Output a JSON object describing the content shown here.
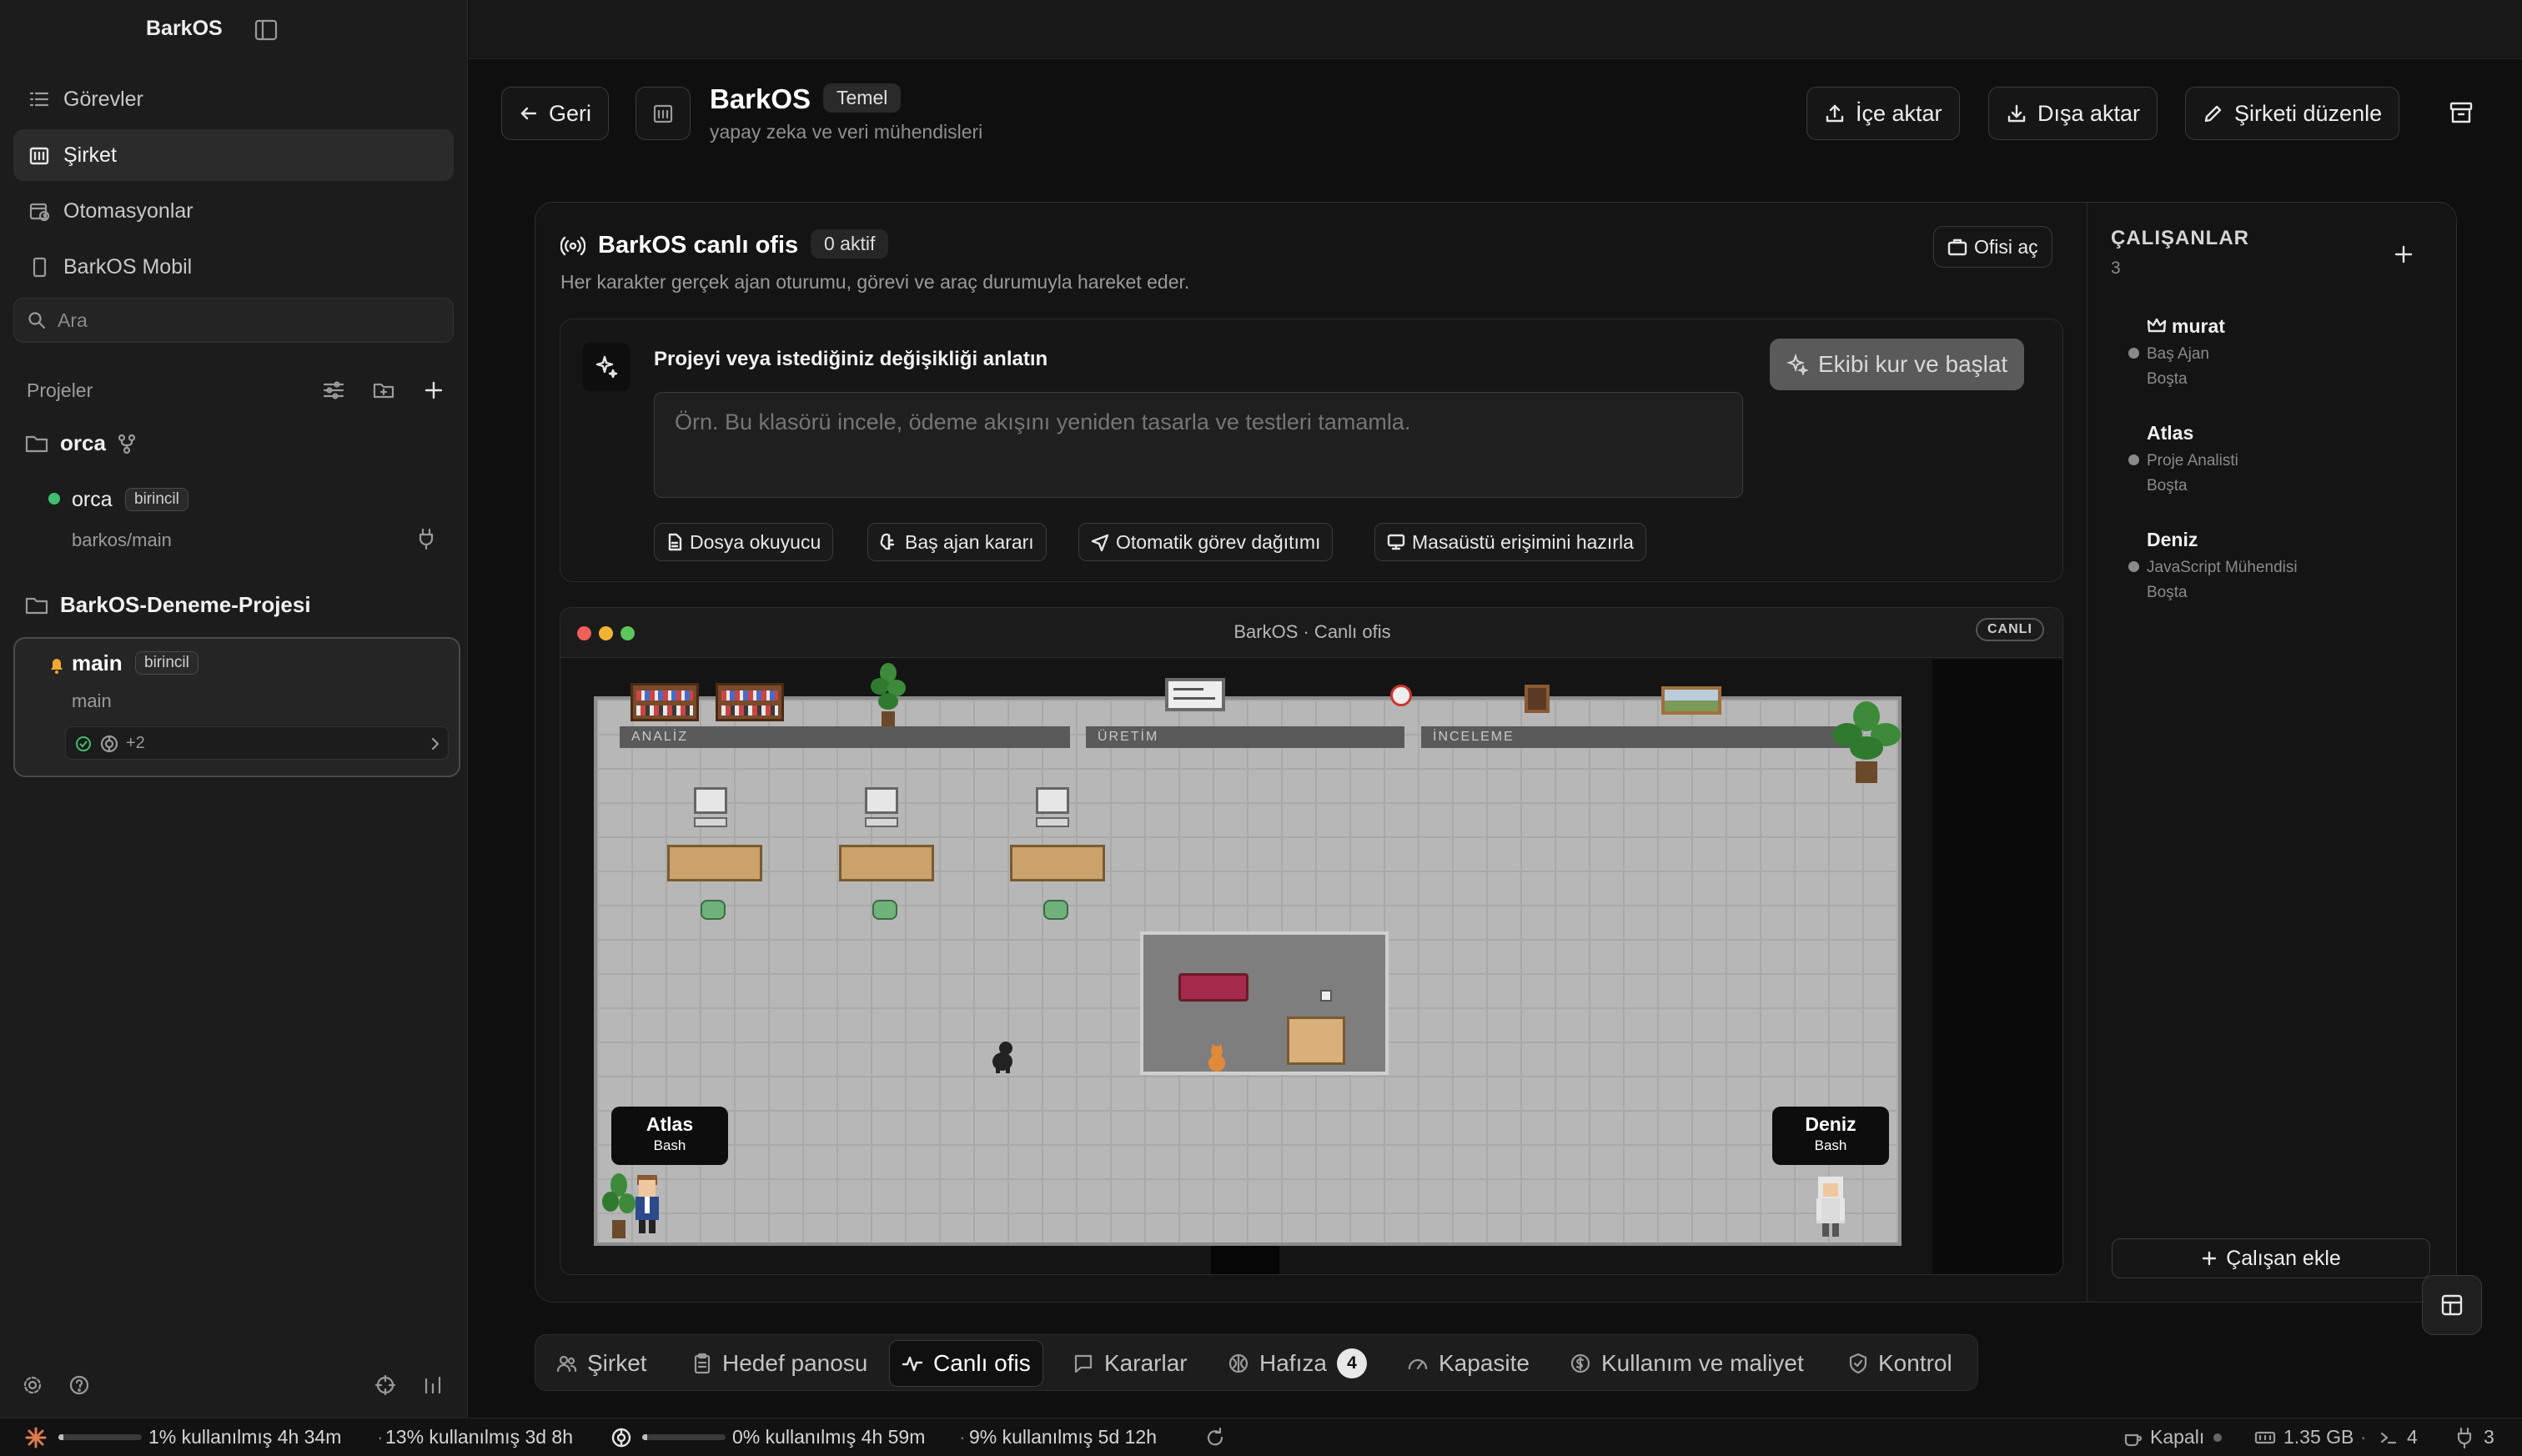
{
  "sidebar": {
    "app_title": "BarkOS",
    "nav": [
      {
        "label": "Görevler",
        "icon": "tasks-icon"
      },
      {
        "label": "Şirket",
        "icon": "company-icon",
        "active": true
      },
      {
        "label": "Otomasyonlar",
        "icon": "calendar-clock-icon"
      },
      {
        "label": "BarkOS Mobil",
        "icon": "mobile-icon"
      }
    ],
    "search_placeholder": "Ara",
    "projects_label": "Projeler",
    "projects": [
      {
        "name": "orca",
        "workspaces": [
          {
            "name": "orca",
            "badge": "birincil",
            "path": "barkos/main",
            "status": "active"
          }
        ]
      },
      {
        "name": "BarkOS-Deneme-Projesi",
        "workspaces": [
          {
            "name": "main",
            "badge": "birincil",
            "path": "main",
            "extra": "+2",
            "status": "notify"
          }
        ]
      }
    ]
  },
  "header": {
    "back_label": "Geri",
    "company_name": "BarkOS",
    "plan_badge": "Temel",
    "company_subtitle": "yapay zeka ve veri mühendisleri",
    "import_label": "İçe aktar",
    "export_label": "Dışa aktar",
    "edit_label": "Şirketi düzenle"
  },
  "office_card": {
    "title": "BarkOS canlı ofis",
    "active_badge": "0 aktif",
    "description": "Her karakter gerçek ajan oturumu, görevi ve araç durumuyla hareket eder.",
    "open_office_label": "Ofisi aç"
  },
  "composer": {
    "title": "Projeyi veya istediğiniz değişikliği anlatın",
    "placeholder": "Örn. Bu klasörü incele, ödeme akışını yeniden tasarla ve testleri tamamla.",
    "submit_label": "Ekibi kur ve başlat",
    "chips": [
      {
        "label": "Dosya okuyucu",
        "icon": "file-icon"
      },
      {
        "label": "Baş ajan kararı",
        "icon": "brain-icon"
      },
      {
        "label": "Otomatik görev dağıtımı",
        "icon": "send-icon"
      },
      {
        "label": "Masaüstü erişimini hazırla",
        "icon": "desktop-icon"
      }
    ]
  },
  "live_office": {
    "window_title": "BarkOS · Canlı ofis",
    "live_badge": "CANLI",
    "zones": [
      "ANALİZ",
      "ÜRETİM",
      "İNCELEME"
    ],
    "agents": [
      {
        "name": "Atlas",
        "tool": "Bash"
      },
      {
        "name": "Deniz",
        "tool": "Bash"
      }
    ]
  },
  "employees": {
    "title": "ÇALIŞANLAR",
    "count": "3",
    "list": [
      {
        "name": "murat",
        "role": "Baş Ajan",
        "status": "Boşta",
        "lead": true
      },
      {
        "name": "Atlas",
        "role": "Proje Analisti",
        "status": "Boşta"
      },
      {
        "name": "Deniz",
        "role": "JavaScript Mühendisi",
        "status": "Boşta"
      }
    ],
    "add_label": "Çalışan ekle"
  },
  "tabs": [
    {
      "label": "Şirket",
      "icon": "users-icon"
    },
    {
      "label": "Hedef panosu",
      "icon": "clipboard-icon"
    },
    {
      "label": "Canlı ofis",
      "icon": "activity-icon",
      "active": true
    },
    {
      "label": "Kararlar",
      "icon": "message-icon"
    },
    {
      "label": "Hafıza",
      "icon": "memory-icon",
      "count": "4"
    },
    {
      "label": "Kapasite",
      "icon": "gauge-icon"
    },
    {
      "label": "Kullanım ve maliyet",
      "icon": "dollar-icon"
    },
    {
      "label": "Kontrol",
      "icon": "shield-icon"
    }
  ],
  "status_bar": {
    "claude_primary": "1% kullanılmış 4h 34m",
    "claude_secondary": "13% kullanılmış 3d 8h",
    "claude_primary_pct": 1,
    "openai_primary": "0% kullanılmış 4h 59m",
    "openai_secondary": "9% kullanılmış 5d 12h",
    "openai_primary_pct": 0,
    "power_label": "Kapalı",
    "memory_label": "1.35 GB",
    "terminals_count": "4",
    "plugins_count": "3"
  },
  "colors": {
    "accent_active": "#3fbf6f",
    "accent_notify": "#f2a72e",
    "claude_orange": "#e07a4f"
  }
}
